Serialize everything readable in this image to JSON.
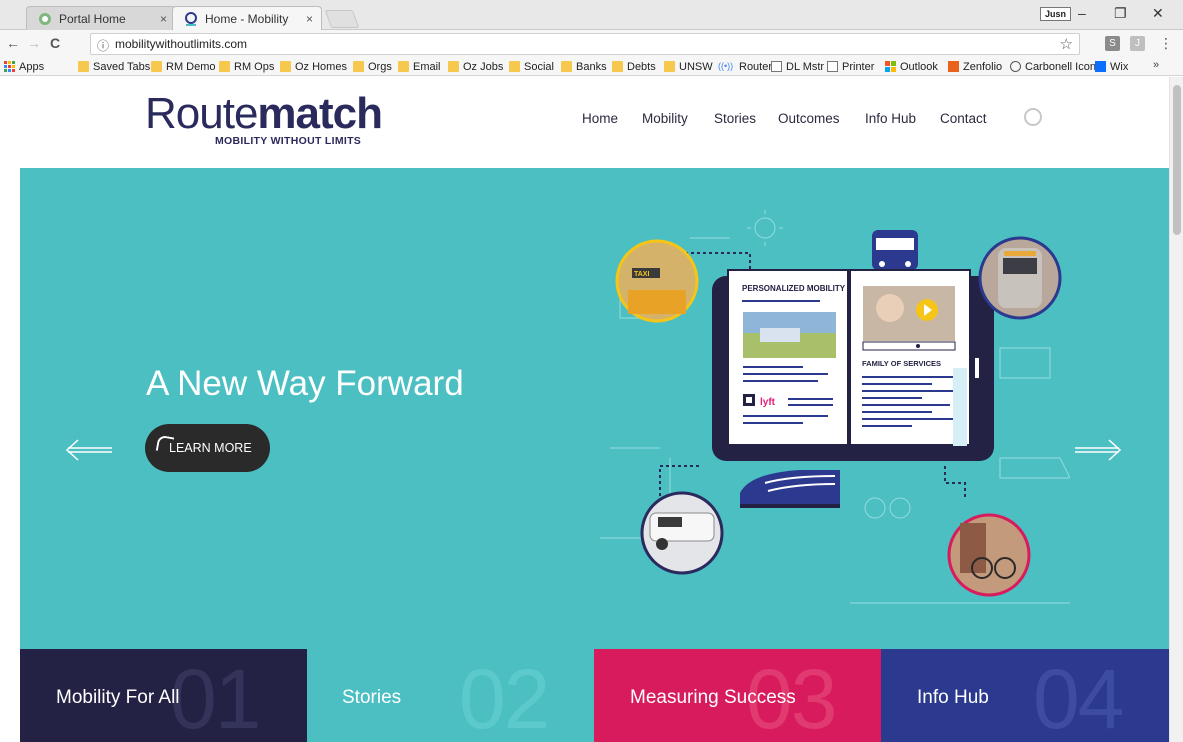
{
  "browser": {
    "tabs": [
      {
        "label": "Portal Home",
        "close": "×",
        "active": false
      },
      {
        "label": "Home - Mobility Withou",
        "close": "×",
        "active": true
      }
    ],
    "user_badge": "Jusn",
    "window_controls": {
      "minimize": "–",
      "restore": "❐",
      "close": "✕"
    },
    "nav": {
      "back": "←",
      "forward": "→",
      "reload": "C"
    },
    "address": {
      "info_icon": "ⓘ",
      "url": "mobilitywithoutlimits.com",
      "star": "☆"
    },
    "extensions": [
      "S",
      "J"
    ],
    "menu": "⋮",
    "bookmarks": [
      {
        "label": "Apps",
        "icon": "apps-grid-icon"
      },
      {
        "label": "Saved Tabs",
        "icon": "folder-icon"
      },
      {
        "label": "RM Demo",
        "icon": "folder-icon"
      },
      {
        "label": "RM Ops",
        "icon": "folder-icon"
      },
      {
        "label": "Oz Homes",
        "icon": "folder-icon"
      },
      {
        "label": "Orgs",
        "icon": "folder-icon"
      },
      {
        "label": "Email",
        "icon": "folder-icon"
      },
      {
        "label": "Oz Jobs",
        "icon": "folder-icon"
      },
      {
        "label": "Social",
        "icon": "folder-icon"
      },
      {
        "label": "Banks",
        "icon": "folder-icon"
      },
      {
        "label": "Debts",
        "icon": "folder-icon"
      },
      {
        "label": "UNSW",
        "icon": "folder-icon"
      },
      {
        "label": "Router",
        "icon": "router-icon"
      },
      {
        "label": "DL Mstr",
        "icon": "page-icon"
      },
      {
        "label": "Printer",
        "icon": "page-icon"
      },
      {
        "label": "Outlook",
        "icon": "windows-icon"
      },
      {
        "label": "Zenfolio",
        "icon": "zenfolio-icon"
      },
      {
        "label": "Carbonell Icon",
        "icon": "carbonell-icon"
      },
      {
        "label": "Wix",
        "icon": "wix-icon"
      }
    ],
    "bookmarks_more": "»"
  },
  "site": {
    "logo": {
      "word_light": "Route",
      "word_bold": "match",
      "tagline": "MOBILITY WITHOUT LIMITS"
    },
    "nav": [
      "Home",
      "Mobility",
      "Stories",
      "Outcomes",
      "Info Hub",
      "Contact"
    ],
    "hero": {
      "headline": "A New Way Forward",
      "button": "LEARN MORE",
      "prev_arrow": "prev-arrow-icon",
      "next_arrow": "next-arrow-icon",
      "illustration": {
        "page_left_heading": "PERSONALIZED MOBILITY",
        "page_right_heading": "FAMILY OF SERVICES",
        "taxi_sign": "TAXI",
        "lyft_logo": "lyft"
      }
    },
    "tiles": [
      {
        "label": "Mobility For All",
        "number": "01",
        "bg": "#232245",
        "num_color": "#34345a"
      },
      {
        "label": "Stories",
        "number": "02",
        "bg": "#4cbfc3",
        "num_color": "#5ccacd"
      },
      {
        "label": "Measuring Success",
        "number": "03",
        "bg": "#d81b5c",
        "num_color": "#e03a71"
      },
      {
        "label": "Info Hub",
        "number": "04",
        "bg": "#2b3a8f",
        "num_color": "#3d4ca0"
      }
    ]
  },
  "colors": {
    "teal": "#4cbfc3",
    "navy": "#2b2a5c",
    "magenta": "#d81b5c",
    "blue": "#2b3a8f"
  }
}
